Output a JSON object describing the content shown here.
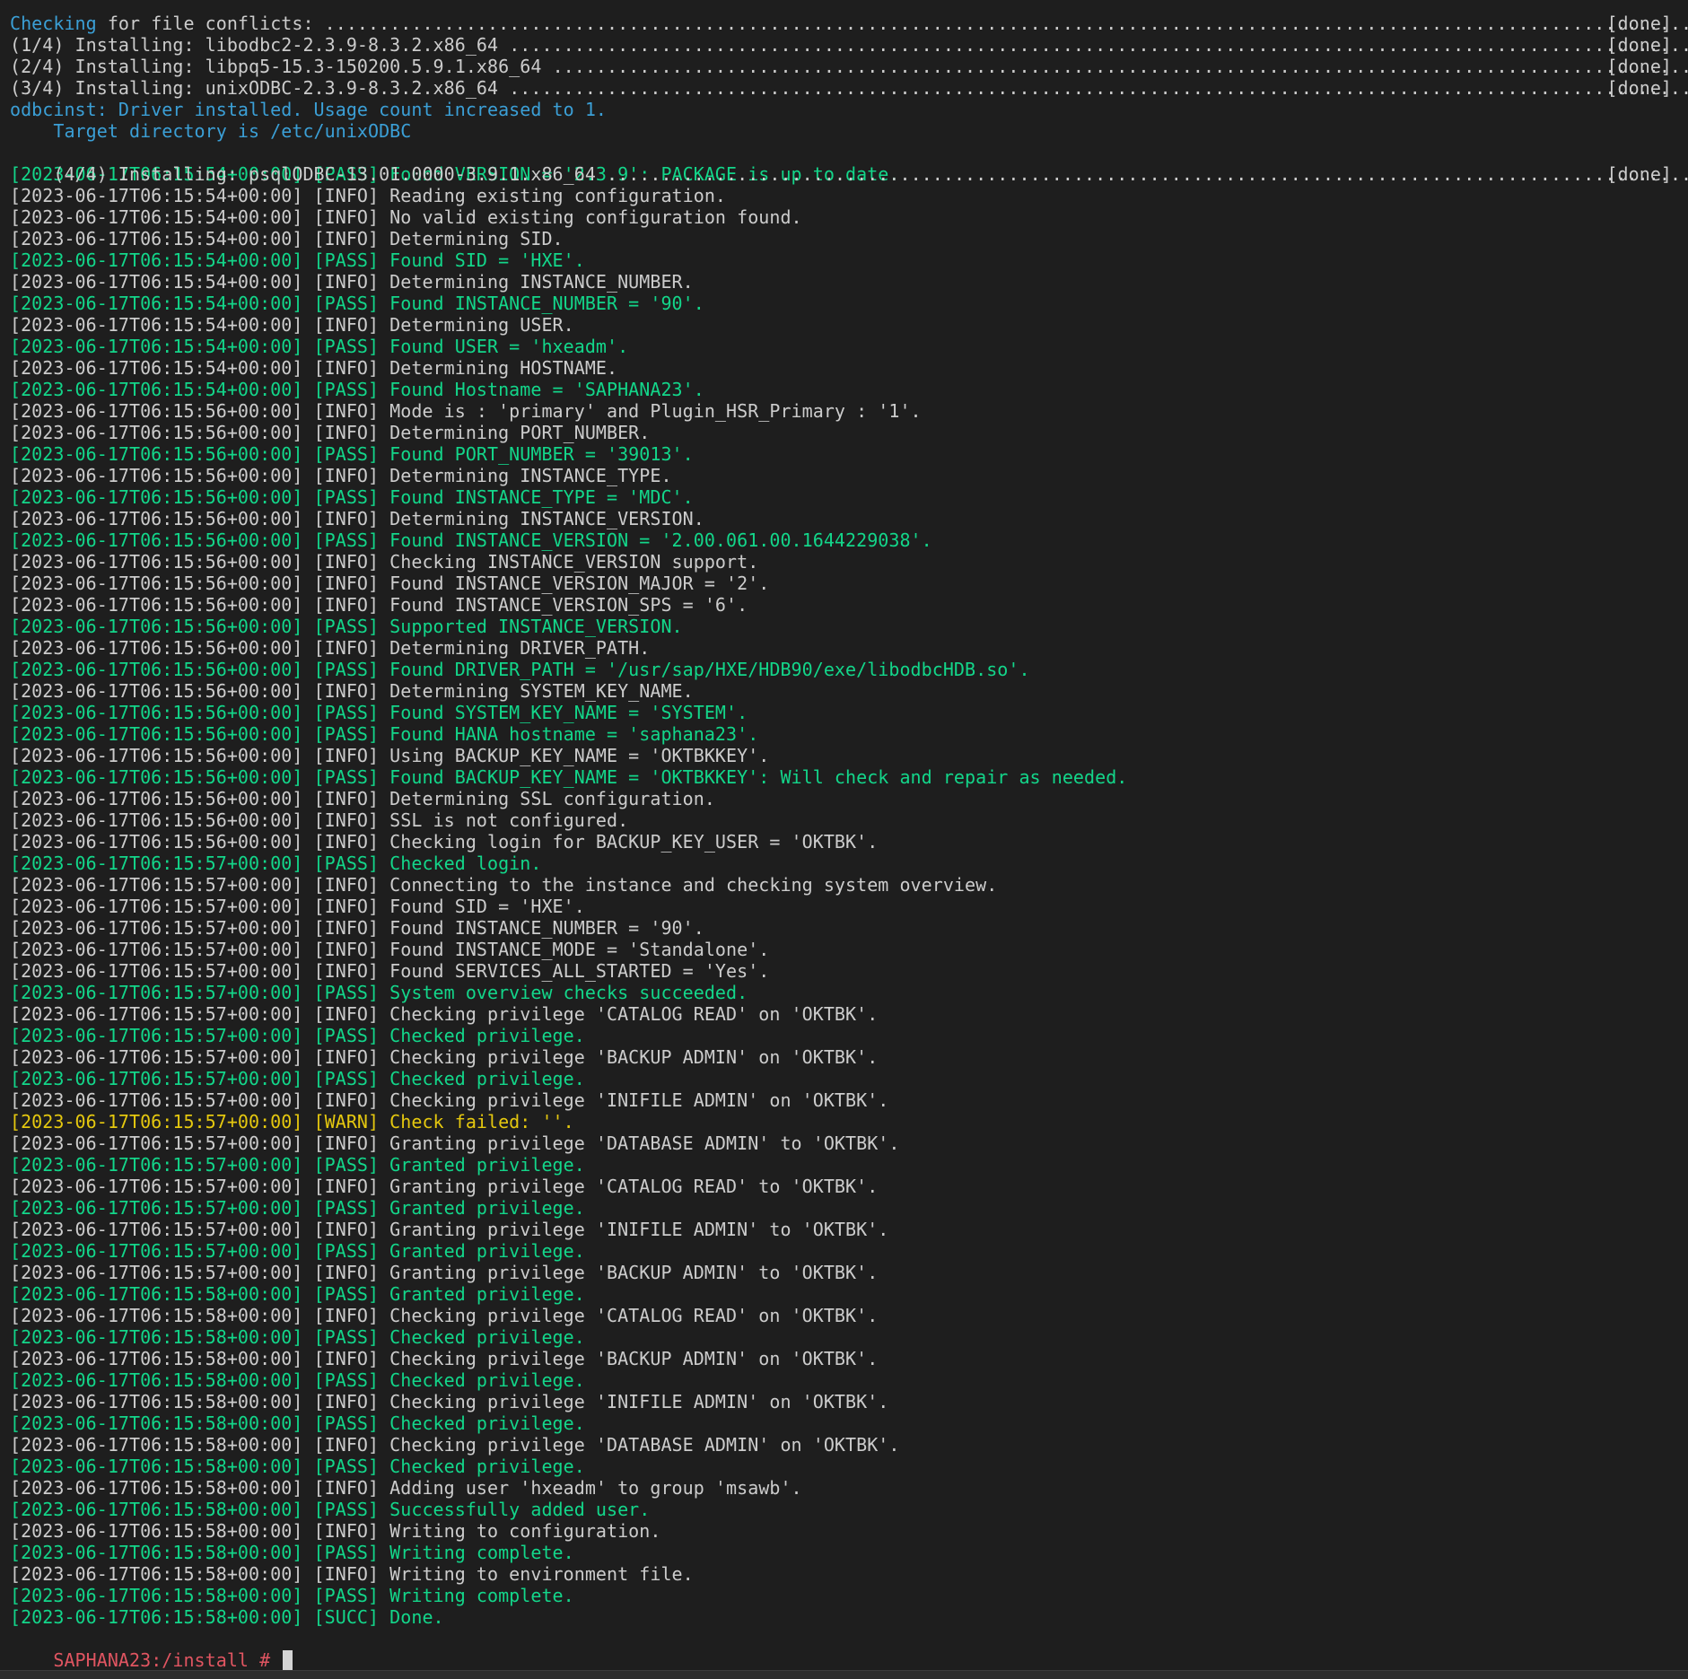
{
  "terminal": {
    "header": [
      {
        "prefix": "Checking",
        "rest": " for file conflicts: ",
        "dots": "..........................................................................................................................................",
        "status": "[done]",
        "prefix_color": "cyan"
      },
      {
        "prefix": "",
        "rest": "(1/4) Installing: libodbc2-2.3.9-8.3.2.x86_64 ",
        "dots": ".......................................................................................................................",
        "status": "[done]"
      },
      {
        "prefix": "",
        "rest": "(2/4) Installing: libpq5-15.3-150200.5.9.1.x86_64 ",
        "dots": "...................................................................................................................",
        "status": "[done]"
      },
      {
        "prefix": "",
        "rest": "(3/4) Installing: unixODBC-2.3.9-8.3.2.x86_64 ",
        "dots": "........................................................................................................................",
        "status": "[done]"
      }
    ],
    "odbc_line1": "odbcinst: Driver installed. Usage count increased to 1.",
    "odbc_line2": "    Target directory is /etc/unixODBC",
    "install4": {
      "rest": "(4/4) Installing: psqlODBC-13.01.0000-3.9.1.x86_64 ",
      "dots": "...................................................................................................................",
      "status": "[done]"
    },
    "log": [
      {
        "level": "pass",
        "text": "[2023-06-17T06:15:54+00:00] [PASS] Found VERSION = '2.3.9': PACKAGE is up to date."
      },
      {
        "level": "info",
        "text": "[2023-06-17T06:15:54+00:00] [INFO] Reading existing configuration."
      },
      {
        "level": "info",
        "text": "[2023-06-17T06:15:54+00:00] [INFO] No valid existing configuration found."
      },
      {
        "level": "info",
        "text": "[2023-06-17T06:15:54+00:00] [INFO] Determining SID."
      },
      {
        "level": "pass",
        "text": "[2023-06-17T06:15:54+00:00] [PASS] Found SID = 'HXE'."
      },
      {
        "level": "info",
        "text": "[2023-06-17T06:15:54+00:00] [INFO] Determining INSTANCE_NUMBER."
      },
      {
        "level": "pass",
        "text": "[2023-06-17T06:15:54+00:00] [PASS] Found INSTANCE_NUMBER = '90'."
      },
      {
        "level": "info",
        "text": "[2023-06-17T06:15:54+00:00] [INFO] Determining USER."
      },
      {
        "level": "pass",
        "text": "[2023-06-17T06:15:54+00:00] [PASS] Found USER = 'hxeadm'."
      },
      {
        "level": "info",
        "text": "[2023-06-17T06:15:54+00:00] [INFO] Determining HOSTNAME."
      },
      {
        "level": "pass",
        "text": "[2023-06-17T06:15:54+00:00] [PASS] Found Hostname = 'SAPHANA23'."
      },
      {
        "level": "info",
        "text": "[2023-06-17T06:15:56+00:00] [INFO] Mode is : 'primary' and Plugin_HSR_Primary : '1'."
      },
      {
        "level": "info",
        "text": "[2023-06-17T06:15:56+00:00] [INFO] Determining PORT_NUMBER."
      },
      {
        "level": "pass",
        "text": "[2023-06-17T06:15:56+00:00] [PASS] Found PORT_NUMBER = '39013'."
      },
      {
        "level": "info",
        "text": "[2023-06-17T06:15:56+00:00] [INFO] Determining INSTANCE_TYPE."
      },
      {
        "level": "pass",
        "text": "[2023-06-17T06:15:56+00:00] [PASS] Found INSTANCE_TYPE = 'MDC'."
      },
      {
        "level": "info",
        "text": "[2023-06-17T06:15:56+00:00] [INFO] Determining INSTANCE_VERSION."
      },
      {
        "level": "pass",
        "text": "[2023-06-17T06:15:56+00:00] [PASS] Found INSTANCE_VERSION = '2.00.061.00.1644229038'."
      },
      {
        "level": "info",
        "text": "[2023-06-17T06:15:56+00:00] [INFO] Checking INSTANCE_VERSION support."
      },
      {
        "level": "info",
        "text": "[2023-06-17T06:15:56+00:00] [INFO] Found INSTANCE_VERSION_MAJOR = '2'."
      },
      {
        "level": "info",
        "text": "[2023-06-17T06:15:56+00:00] [INFO] Found INSTANCE_VERSION_SPS = '6'."
      },
      {
        "level": "pass",
        "text": "[2023-06-17T06:15:56+00:00] [PASS] Supported INSTANCE_VERSION."
      },
      {
        "level": "info",
        "text": "[2023-06-17T06:15:56+00:00] [INFO] Determining DRIVER_PATH."
      },
      {
        "level": "pass",
        "text": "[2023-06-17T06:15:56+00:00] [PASS] Found DRIVER_PATH = '/usr/sap/HXE/HDB90/exe/libodbcHDB.so'."
      },
      {
        "level": "info",
        "text": "[2023-06-17T06:15:56+00:00] [INFO] Determining SYSTEM_KEY_NAME."
      },
      {
        "level": "pass",
        "text": "[2023-06-17T06:15:56+00:00] [PASS] Found SYSTEM_KEY_NAME = 'SYSTEM'."
      },
      {
        "level": "pass",
        "text": "[2023-06-17T06:15:56+00:00] [PASS] Found HANA hostname = 'saphana23'."
      },
      {
        "level": "info",
        "text": "[2023-06-17T06:15:56+00:00] [INFO] Using BACKUP_KEY_NAME = 'OKTBKKEY'."
      },
      {
        "level": "pass",
        "text": "[2023-06-17T06:15:56+00:00] [PASS] Found BACKUP_KEY_NAME = 'OKTBKKEY': Will check and repair as needed."
      },
      {
        "level": "info",
        "text": "[2023-06-17T06:15:56+00:00] [INFO] Determining SSL configuration."
      },
      {
        "level": "info",
        "text": "[2023-06-17T06:15:56+00:00] [INFO] SSL is not configured."
      },
      {
        "level": "info",
        "text": "[2023-06-17T06:15:56+00:00] [INFO] Checking login for BACKUP_KEY_USER = 'OKTBK'."
      },
      {
        "level": "pass",
        "text": "[2023-06-17T06:15:57+00:00] [PASS] Checked login."
      },
      {
        "level": "info",
        "text": "[2023-06-17T06:15:57+00:00] [INFO] Connecting to the instance and checking system overview."
      },
      {
        "level": "info",
        "text": "[2023-06-17T06:15:57+00:00] [INFO] Found SID = 'HXE'."
      },
      {
        "level": "info",
        "text": "[2023-06-17T06:15:57+00:00] [INFO] Found INSTANCE_NUMBER = '90'."
      },
      {
        "level": "info",
        "text": "[2023-06-17T06:15:57+00:00] [INFO] Found INSTANCE_MODE = 'Standalone'."
      },
      {
        "level": "info",
        "text": "[2023-06-17T06:15:57+00:00] [INFO] Found SERVICES_ALL_STARTED = 'Yes'."
      },
      {
        "level": "pass",
        "text": "[2023-06-17T06:15:57+00:00] [PASS] System overview checks succeeded."
      },
      {
        "level": "info",
        "text": "[2023-06-17T06:15:57+00:00] [INFO] Checking privilege 'CATALOG READ' on 'OKTBK'."
      },
      {
        "level": "pass",
        "text": "[2023-06-17T06:15:57+00:00] [PASS] Checked privilege."
      },
      {
        "level": "info",
        "text": "[2023-06-17T06:15:57+00:00] [INFO] Checking privilege 'BACKUP ADMIN' on 'OKTBK'."
      },
      {
        "level": "pass",
        "text": "[2023-06-17T06:15:57+00:00] [PASS] Checked privilege."
      },
      {
        "level": "info",
        "text": "[2023-06-17T06:15:57+00:00] [INFO] Checking privilege 'INIFILE ADMIN' on 'OKTBK'."
      },
      {
        "level": "warn",
        "text": "[2023-06-17T06:15:57+00:00] [WARN] Check failed: ''."
      },
      {
        "level": "info",
        "text": "[2023-06-17T06:15:57+00:00] [INFO] Granting privilege 'DATABASE ADMIN' to 'OKTBK'."
      },
      {
        "level": "pass",
        "text": "[2023-06-17T06:15:57+00:00] [PASS] Granted privilege."
      },
      {
        "level": "info",
        "text": "[2023-06-17T06:15:57+00:00] [INFO] Granting privilege 'CATALOG READ' to 'OKTBK'."
      },
      {
        "level": "pass",
        "text": "[2023-06-17T06:15:57+00:00] [PASS] Granted privilege."
      },
      {
        "level": "info",
        "text": "[2023-06-17T06:15:57+00:00] [INFO] Granting privilege 'INIFILE ADMIN' to 'OKTBK'."
      },
      {
        "level": "pass",
        "text": "[2023-06-17T06:15:57+00:00] [PASS] Granted privilege."
      },
      {
        "level": "info",
        "text": "[2023-06-17T06:15:57+00:00] [INFO] Granting privilege 'BACKUP ADMIN' to 'OKTBK'."
      },
      {
        "level": "pass",
        "text": "[2023-06-17T06:15:58+00:00] [PASS] Granted privilege."
      },
      {
        "level": "info",
        "text": "[2023-06-17T06:15:58+00:00] [INFO] Checking privilege 'CATALOG READ' on 'OKTBK'."
      },
      {
        "level": "pass",
        "text": "[2023-06-17T06:15:58+00:00] [PASS] Checked privilege."
      },
      {
        "level": "info",
        "text": "[2023-06-17T06:15:58+00:00] [INFO] Checking privilege 'BACKUP ADMIN' on 'OKTBK'."
      },
      {
        "level": "pass",
        "text": "[2023-06-17T06:15:58+00:00] [PASS] Checked privilege."
      },
      {
        "level": "info",
        "text": "[2023-06-17T06:15:58+00:00] [INFO] Checking privilege 'INIFILE ADMIN' on 'OKTBK'."
      },
      {
        "level": "pass",
        "text": "[2023-06-17T06:15:58+00:00] [PASS] Checked privilege."
      },
      {
        "level": "info",
        "text": "[2023-06-17T06:15:58+00:00] [INFO] Checking privilege 'DATABASE ADMIN' on 'OKTBK'."
      },
      {
        "level": "pass",
        "text": "[2023-06-17T06:15:58+00:00] [PASS] Checked privilege."
      },
      {
        "level": "info",
        "text": "[2023-06-17T06:15:58+00:00] [INFO] Adding user 'hxeadm' to group 'msawb'."
      },
      {
        "level": "pass",
        "text": "[2023-06-17T06:15:58+00:00] [PASS] Successfully added user."
      },
      {
        "level": "info",
        "text": "[2023-06-17T06:15:58+00:00] [INFO] Writing to configuration."
      },
      {
        "level": "pass",
        "text": "[2023-06-17T06:15:58+00:00] [PASS] Writing complete."
      },
      {
        "level": "info",
        "text": "[2023-06-17T06:15:58+00:00] [INFO] Writing to environment file."
      },
      {
        "level": "pass",
        "text": "[2023-06-17T06:15:58+00:00] [PASS] Writing complete."
      },
      {
        "level": "succ",
        "text": "[2023-06-17T06:15:58+00:00] [SUCC] Done."
      }
    ],
    "prompt": "SAPHANA23:/install # "
  },
  "colors": {
    "background": "#1e1e1e",
    "default_text": "#cccccc",
    "pass": "#13d68a",
    "warn": "#e5c80f",
    "cyan": "#3b9fd6",
    "prompt": "#e05561"
  }
}
